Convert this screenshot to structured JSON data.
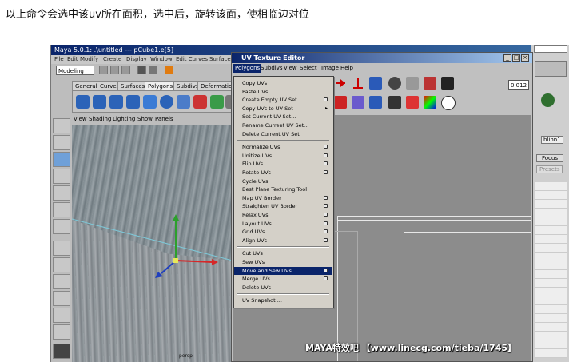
{
  "caption": "以上命令会选中该uv所在面积，选中后，旋转该面，使相临边对位",
  "maya": {
    "title": "Maya 5.0.1: .\\untitled  ---  pCube1.e[5]",
    "menus": [
      "File",
      "Edit",
      "Modify",
      "Create",
      "Display",
      "Window",
      "Edit Curves",
      "Surface"
    ],
    "mode": "Modeling",
    "shelf_tabs": [
      "General",
      "Curves",
      "Surfaces",
      "Polygons",
      "Subdivs",
      "Deformation"
    ],
    "active_shelf_tab": "Polygons",
    "panel_menus": [
      "View",
      "Shading",
      "Lighting",
      "Show",
      "Panels"
    ],
    "viewport_label": "persp",
    "right_panel": {
      "tab": "blinn1",
      "button": "Focus",
      "button2": "Presets"
    }
  },
  "uv_editor": {
    "title": "UV Texture Editor",
    "menus": [
      "Polygons",
      "Subdivs",
      "View",
      "Select",
      "Image",
      "Help"
    ],
    "active_menu": "Polygons",
    "field_value": "0.012",
    "polygons_menu": [
      {
        "label": "Copy UVs",
        "option": false
      },
      {
        "label": "Paste UVs",
        "option": false
      },
      {
        "label": "Create Empty UV Set",
        "option": true
      },
      {
        "label": "Copy UVs to UV Set",
        "submenu": true
      },
      {
        "label": "Set Current UV Set...",
        "option": false
      },
      {
        "label": "Rename Current UV Set...",
        "option": false
      },
      {
        "label": "Delete Current UV Set",
        "option": false
      },
      {
        "separator": true
      },
      {
        "label": "Normalize UVs",
        "option": true
      },
      {
        "label": "Unitize UVs",
        "option": true
      },
      {
        "label": "Flip UVs",
        "option": true
      },
      {
        "label": "Rotate UVs",
        "option": true
      },
      {
        "label": "Cycle UVs",
        "option": false
      },
      {
        "label": "Best Plane Texturing Tool",
        "option": false
      },
      {
        "label": "Map UV Border",
        "option": true
      },
      {
        "label": "Straighten UV Border",
        "option": true
      },
      {
        "label": "Relax UVs",
        "option": true
      },
      {
        "label": "Layout UVs",
        "option": true
      },
      {
        "label": "Grid UVs",
        "option": true
      },
      {
        "label": "Align UVs",
        "option": true
      },
      {
        "separator": true
      },
      {
        "label": "Cut UVs",
        "option": false
      },
      {
        "label": "Sew UVs",
        "option": false
      },
      {
        "label": "Move and Sew UVs",
        "option": true,
        "highlighted": true
      },
      {
        "label": "Merge UVs",
        "option": true
      },
      {
        "label": "Delete UVs",
        "option": false
      },
      {
        "separator": true
      },
      {
        "label": "UV Snapshot ...",
        "option": false
      }
    ]
  },
  "watermark": "MAYA特效吧 【www.linecg.com/tieba/1745】"
}
